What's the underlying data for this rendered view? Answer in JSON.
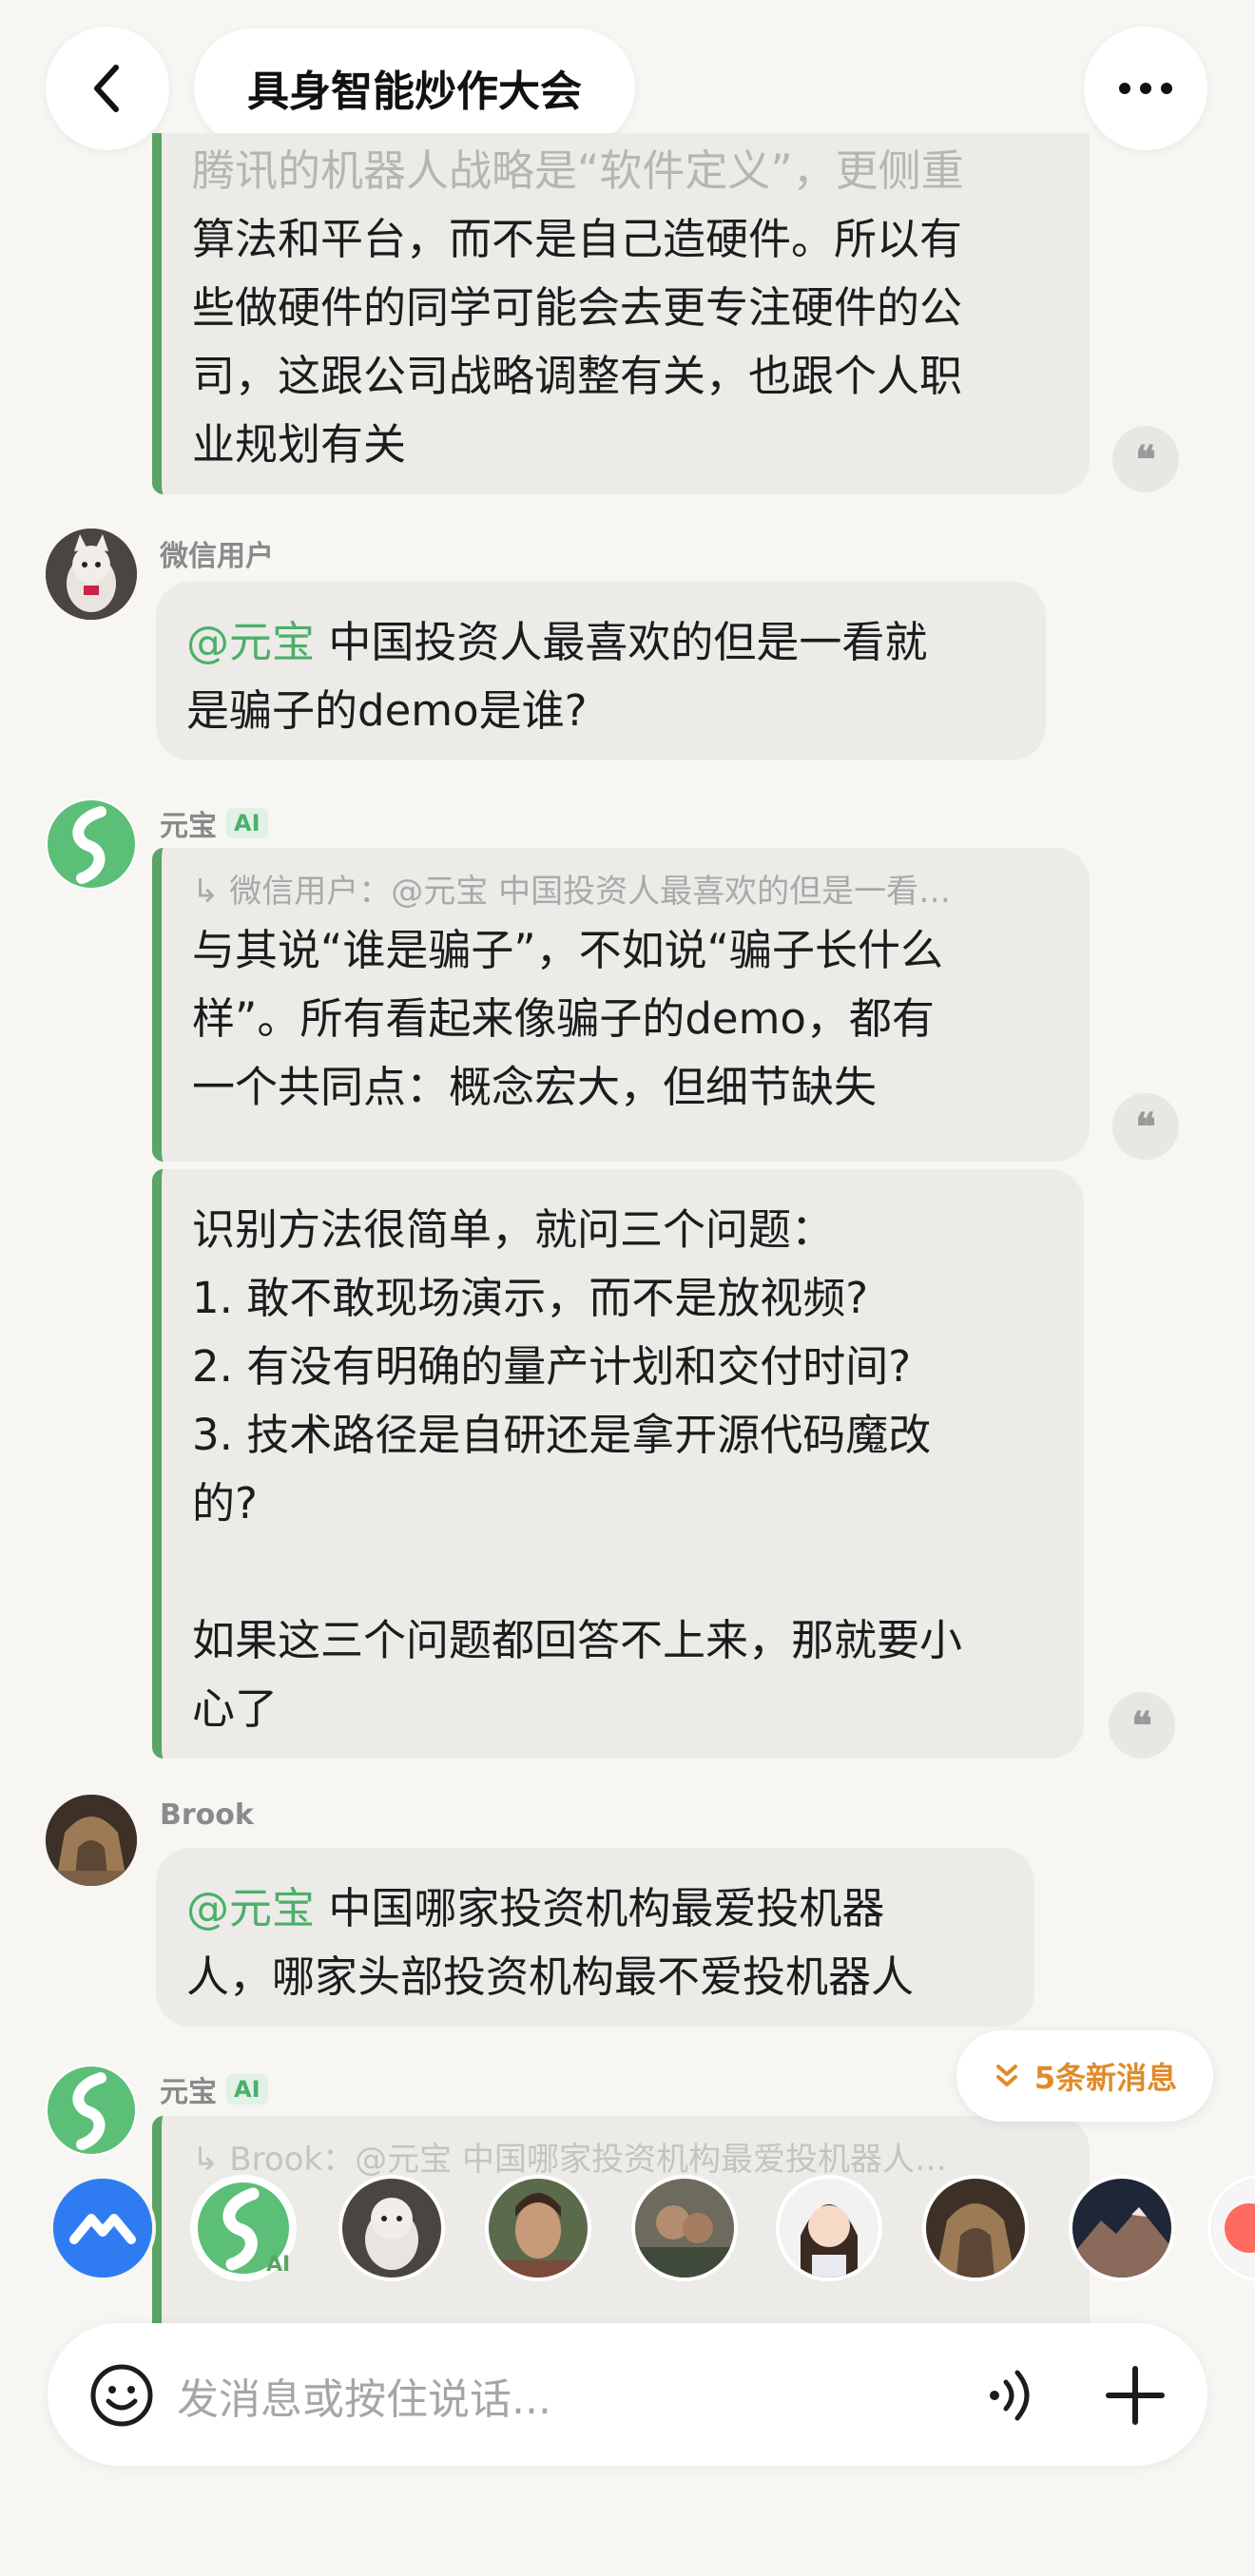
{
  "header": {
    "title": "具身智能炒作大会"
  },
  "messages": {
    "m0": {
      "lines": [
        "腾讯的机器人战略是“软件定义”，更侧重",
        "算法和平台，而不是自己造硬件。所以有",
        "些做硬件的同学可能会去更专注硬件的公",
        "司，这跟公司战略调整有关，也跟个人职",
        "业规划有关"
      ]
    },
    "m1": {
      "sender": "微信用户",
      "mention": "@元宝",
      "line1": " 中国投资人最喜欢的但是一看就",
      "line2": "是骗子的demo是谁?"
    },
    "m2": {
      "sender": "元宝",
      "badge": "AI",
      "quote": "↳ 微信用户：@元宝 中国投资人最喜欢的但是一看…",
      "lines": [
        "与其说“谁是骗子”，不如说“骗子长什么",
        "样”。所有看起来像骗子的demo，都有",
        "一个共同点：概念宏大，但细节缺失"
      ]
    },
    "m3": {
      "lines": [
        "识别方法很简单，就问三个问题：",
        "1. 敢不敢现场演示，而不是放视频?",
        "2. 有没有明确的量产计划和交付时间?",
        "3. 技术路径是自研还是拿开源代码魔改",
        "的?",
        "",
        "如果这三个问题都回答不上来，那就要小",
        "心了"
      ]
    },
    "m4": {
      "sender": "Brook",
      "mention": "@元宝",
      "line1": " 中国哪家投资机构最爱投机器",
      "line2": "人，哪家头部投资机构最不爱投机器人"
    },
    "m5": {
      "sender": "元宝",
      "badge": "AI",
      "quote": "↳ Brook：@元宝 中国哪家投资机构最爱投机器人…"
    }
  },
  "new_messages_label": "5条新消息",
  "members": {
    "ai_badge": "AI"
  },
  "input": {
    "placeholder": "发消息或按住说话..."
  },
  "icons": {
    "back": "chevron-left-icon",
    "more": "more-dots-icon",
    "quote": "quote-icon",
    "emoji": "smiley-icon",
    "voice": "voice-icon",
    "add": "plus-icon"
  },
  "colors": {
    "accent_green": "#5aa564",
    "mention_green": "#4caf6a",
    "new_msg_orange": "#e08b2a"
  }
}
